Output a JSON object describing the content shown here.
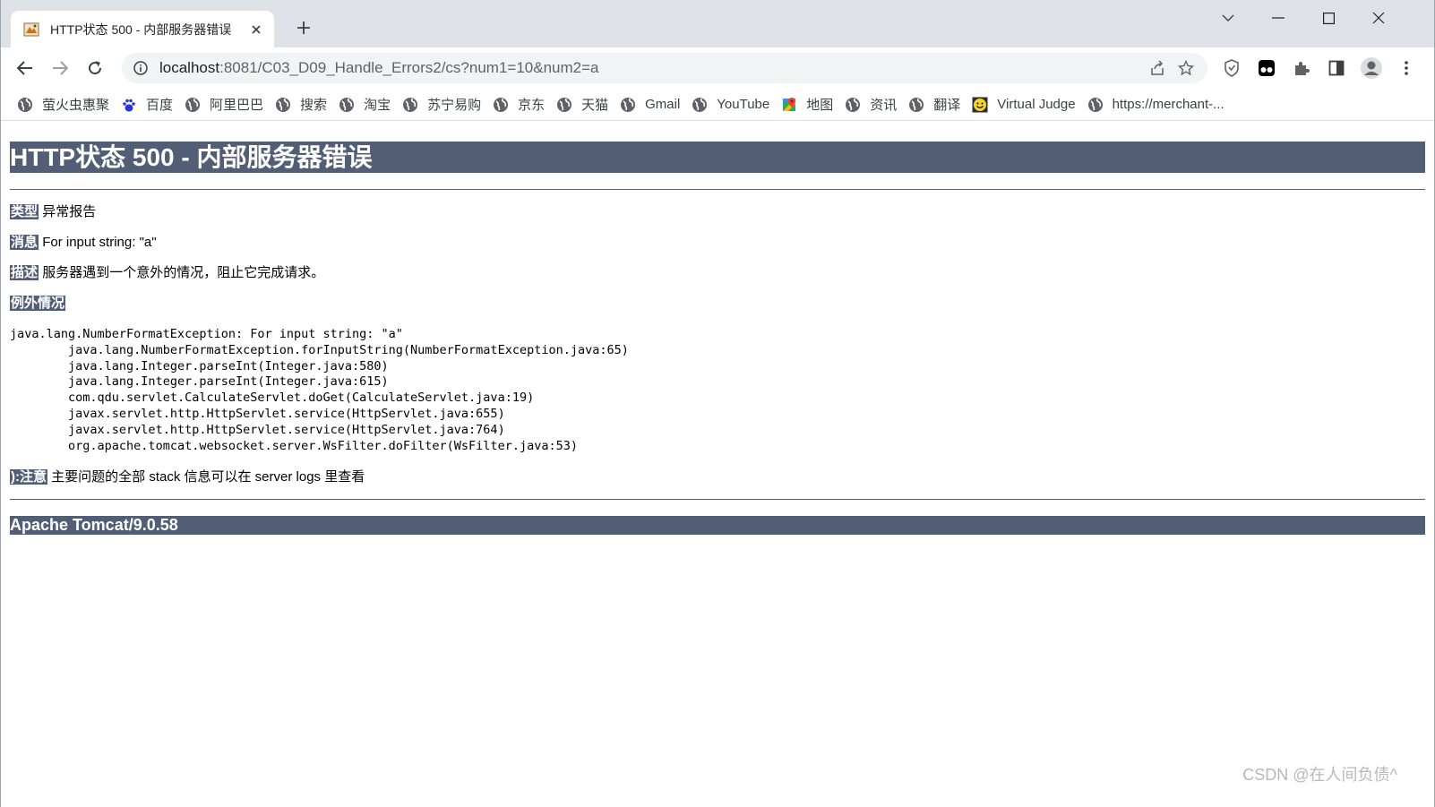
{
  "browser": {
    "tab": {
      "title": "HTTP状态 500 - 内部服务器错误",
      "close_icon": "close-icon",
      "favicon": "tomcat-favicon"
    },
    "new_tab_label": "+",
    "window_controls": [
      "tab-search-icon",
      "minimize-icon",
      "maximize-icon",
      "close-icon"
    ],
    "address_bar": {
      "host": "localhost",
      "path": ":8081/C03_D09_Handle_Errors2/cs?num1=10&num2=a"
    },
    "bookmarks": [
      {
        "label": "萤火虫惠聚",
        "icon": "globe-icon"
      },
      {
        "label": "百度",
        "icon": "baidu-paw-icon"
      },
      {
        "label": "阿里巴巴",
        "icon": "globe-icon"
      },
      {
        "label": "搜索",
        "icon": "globe-icon"
      },
      {
        "label": "淘宝",
        "icon": "globe-icon"
      },
      {
        "label": "苏宁易购",
        "icon": "globe-icon"
      },
      {
        "label": "京东",
        "icon": "globe-icon"
      },
      {
        "label": "天猫",
        "icon": "globe-icon"
      },
      {
        "label": "Gmail",
        "icon": "globe-icon"
      },
      {
        "label": "YouTube",
        "icon": "globe-icon"
      },
      {
        "label": "地图",
        "icon": "maps-icon"
      },
      {
        "label": "资讯",
        "icon": "globe-icon"
      },
      {
        "label": "翻译",
        "icon": "globe-icon"
      },
      {
        "label": "Virtual Judge",
        "icon": "smiley-icon"
      },
      {
        "label": "https://merchant-...",
        "icon": "globe-icon"
      }
    ]
  },
  "error_page": {
    "title": "HTTP状态 500 - 内部服务器错误",
    "type_label": "类型",
    "type_value": "异常报告",
    "message_label": "消息",
    "message_value": "For input string: \"a\"",
    "description_label": "描述",
    "description_value": "服务器遇到一个意外的情况，阻止它完成请求。",
    "exception_label": "例外情况",
    "stack_trace": "java.lang.NumberFormatException: For input string: \"a\"\n\tjava.lang.NumberFormatException.forInputString(NumberFormatException.java:65)\n\tjava.lang.Integer.parseInt(Integer.java:580)\n\tjava.lang.Integer.parseInt(Integer.java:615)\n\tcom.qdu.servlet.CalculateServlet.doGet(CalculateServlet.java:19)\n\tjavax.servlet.http.HttpServlet.service(HttpServlet.java:655)\n\tjavax.servlet.http.HttpServlet.service(HttpServlet.java:764)\n\torg.apache.tomcat.websocket.server.WsFilter.doFilter(WsFilter.java:53)",
    "note_label": "):注意",
    "note_value": "主要问题的全部 stack 信息可以在 server logs 里查看",
    "footer": "Apache Tomcat/9.0.58"
  },
  "watermark": "CSDN @在人间负债^",
  "colors": {
    "tomcat_bar": "#525d76",
    "chrome_bg": "#dee1e6",
    "omnibox_bg": "#f1f3f4"
  }
}
